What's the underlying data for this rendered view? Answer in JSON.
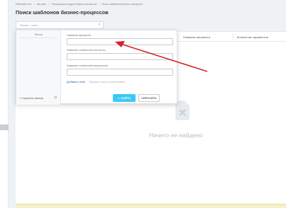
{
  "breadcrumbs": [
    "Рабочий стол",
    "Битрикс",
    "Расширение модуля бизнес-процессы",
    "Поиск шаблонов бизнес-процесса"
  ],
  "page": {
    "title": "Поиск шаблонов бизнес-процессов"
  },
  "filter": {
    "placeholder": "Фильтр + поиск"
  },
  "grid": {
    "columns": [
      "Название аргумента",
      "Количество аргументов"
    ],
    "empty_text": "Ничего не найдено"
  },
  "popup": {
    "preset_header": "Фильтр",
    "save_filter": "Сохранить фильтр",
    "fields": [
      {
        "label": "Название аргумента",
        "value": ""
      },
      {
        "label": "Название глобальной константы",
        "value": ""
      },
      {
        "label": "Название глобальной переменной",
        "value": ""
      }
    ],
    "add_field": "Добавить поле",
    "restore_fields": "Вернуть поля по умолчанию",
    "find_label": "НАЙТИ",
    "reset_label": "СБРОСИТЬ"
  },
  "colors": {
    "accent": "#3bc8f5",
    "arrow": "#d6222a",
    "link": "#2067b0"
  }
}
